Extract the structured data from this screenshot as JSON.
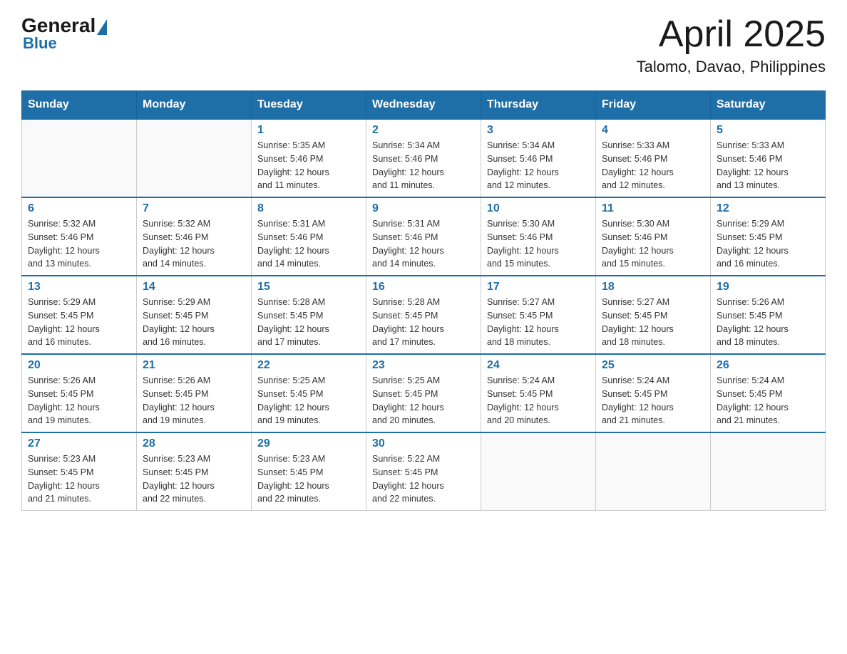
{
  "header": {
    "logo": {
      "general": "General",
      "blue": "Blue"
    },
    "title": "April 2025",
    "subtitle": "Talomo, Davao, Philippines"
  },
  "days_of_week": [
    "Sunday",
    "Monday",
    "Tuesday",
    "Wednesday",
    "Thursday",
    "Friday",
    "Saturday"
  ],
  "weeks": [
    {
      "days": [
        {
          "number": "",
          "info": ""
        },
        {
          "number": "",
          "info": ""
        },
        {
          "number": "1",
          "info": "Sunrise: 5:35 AM\nSunset: 5:46 PM\nDaylight: 12 hours\nand 11 minutes."
        },
        {
          "number": "2",
          "info": "Sunrise: 5:34 AM\nSunset: 5:46 PM\nDaylight: 12 hours\nand 11 minutes."
        },
        {
          "number": "3",
          "info": "Sunrise: 5:34 AM\nSunset: 5:46 PM\nDaylight: 12 hours\nand 12 minutes."
        },
        {
          "number": "4",
          "info": "Sunrise: 5:33 AM\nSunset: 5:46 PM\nDaylight: 12 hours\nand 12 minutes."
        },
        {
          "number": "5",
          "info": "Sunrise: 5:33 AM\nSunset: 5:46 PM\nDaylight: 12 hours\nand 13 minutes."
        }
      ]
    },
    {
      "days": [
        {
          "number": "6",
          "info": "Sunrise: 5:32 AM\nSunset: 5:46 PM\nDaylight: 12 hours\nand 13 minutes."
        },
        {
          "number": "7",
          "info": "Sunrise: 5:32 AM\nSunset: 5:46 PM\nDaylight: 12 hours\nand 14 minutes."
        },
        {
          "number": "8",
          "info": "Sunrise: 5:31 AM\nSunset: 5:46 PM\nDaylight: 12 hours\nand 14 minutes."
        },
        {
          "number": "9",
          "info": "Sunrise: 5:31 AM\nSunset: 5:46 PM\nDaylight: 12 hours\nand 14 minutes."
        },
        {
          "number": "10",
          "info": "Sunrise: 5:30 AM\nSunset: 5:46 PM\nDaylight: 12 hours\nand 15 minutes."
        },
        {
          "number": "11",
          "info": "Sunrise: 5:30 AM\nSunset: 5:46 PM\nDaylight: 12 hours\nand 15 minutes."
        },
        {
          "number": "12",
          "info": "Sunrise: 5:29 AM\nSunset: 5:45 PM\nDaylight: 12 hours\nand 16 minutes."
        }
      ]
    },
    {
      "days": [
        {
          "number": "13",
          "info": "Sunrise: 5:29 AM\nSunset: 5:45 PM\nDaylight: 12 hours\nand 16 minutes."
        },
        {
          "number": "14",
          "info": "Sunrise: 5:29 AM\nSunset: 5:45 PM\nDaylight: 12 hours\nand 16 minutes."
        },
        {
          "number": "15",
          "info": "Sunrise: 5:28 AM\nSunset: 5:45 PM\nDaylight: 12 hours\nand 17 minutes."
        },
        {
          "number": "16",
          "info": "Sunrise: 5:28 AM\nSunset: 5:45 PM\nDaylight: 12 hours\nand 17 minutes."
        },
        {
          "number": "17",
          "info": "Sunrise: 5:27 AM\nSunset: 5:45 PM\nDaylight: 12 hours\nand 18 minutes."
        },
        {
          "number": "18",
          "info": "Sunrise: 5:27 AM\nSunset: 5:45 PM\nDaylight: 12 hours\nand 18 minutes."
        },
        {
          "number": "19",
          "info": "Sunrise: 5:26 AM\nSunset: 5:45 PM\nDaylight: 12 hours\nand 18 minutes."
        }
      ]
    },
    {
      "days": [
        {
          "number": "20",
          "info": "Sunrise: 5:26 AM\nSunset: 5:45 PM\nDaylight: 12 hours\nand 19 minutes."
        },
        {
          "number": "21",
          "info": "Sunrise: 5:26 AM\nSunset: 5:45 PM\nDaylight: 12 hours\nand 19 minutes."
        },
        {
          "number": "22",
          "info": "Sunrise: 5:25 AM\nSunset: 5:45 PM\nDaylight: 12 hours\nand 19 minutes."
        },
        {
          "number": "23",
          "info": "Sunrise: 5:25 AM\nSunset: 5:45 PM\nDaylight: 12 hours\nand 20 minutes."
        },
        {
          "number": "24",
          "info": "Sunrise: 5:24 AM\nSunset: 5:45 PM\nDaylight: 12 hours\nand 20 minutes."
        },
        {
          "number": "25",
          "info": "Sunrise: 5:24 AM\nSunset: 5:45 PM\nDaylight: 12 hours\nand 21 minutes."
        },
        {
          "number": "26",
          "info": "Sunrise: 5:24 AM\nSunset: 5:45 PM\nDaylight: 12 hours\nand 21 minutes."
        }
      ]
    },
    {
      "days": [
        {
          "number": "27",
          "info": "Sunrise: 5:23 AM\nSunset: 5:45 PM\nDaylight: 12 hours\nand 21 minutes."
        },
        {
          "number": "28",
          "info": "Sunrise: 5:23 AM\nSunset: 5:45 PM\nDaylight: 12 hours\nand 22 minutes."
        },
        {
          "number": "29",
          "info": "Sunrise: 5:23 AM\nSunset: 5:45 PM\nDaylight: 12 hours\nand 22 minutes."
        },
        {
          "number": "30",
          "info": "Sunrise: 5:22 AM\nSunset: 5:45 PM\nDaylight: 12 hours\nand 22 minutes."
        },
        {
          "number": "",
          "info": ""
        },
        {
          "number": "",
          "info": ""
        },
        {
          "number": "",
          "info": ""
        }
      ]
    }
  ]
}
